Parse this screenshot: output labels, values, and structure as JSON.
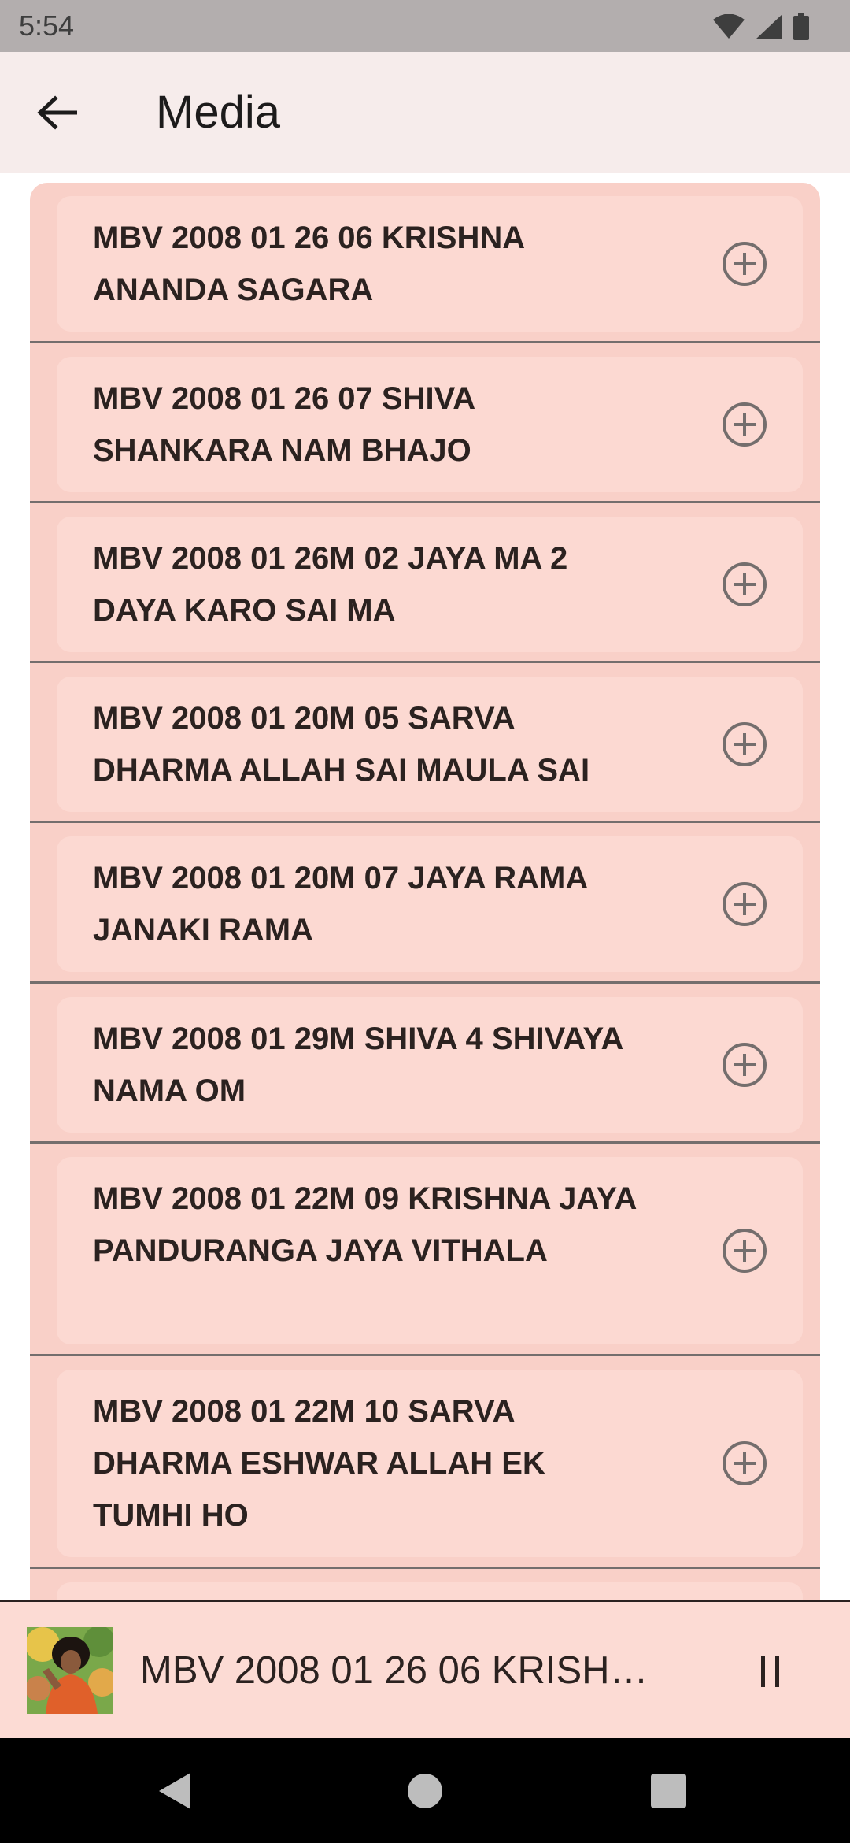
{
  "status_bar": {
    "time": "5:54"
  },
  "app_bar": {
    "title": "Media",
    "back_icon": "arrow-left-icon"
  },
  "media_list": [
    {
      "title": "MBV 2008 01 26 06 KRISHNA ANANDA SAGARA"
    },
    {
      "title": "MBV 2008 01 26 07 SHIVA SHANKARA NAM BHAJO"
    },
    {
      "title": "MBV 2008 01 26M 02 JAYA MA 2 DAYA KARO SAI MA"
    },
    {
      "title": "MBV 2008 01 20M 05 SARVA DHARMA ALLAH SAI MAULA SAI"
    },
    {
      "title": "MBV 2008 01 20M 07 JAYA RAMA JANAKI RAMA"
    },
    {
      "title": "MBV 2008 01 29M SHIVA 4 SHIVAYA NAMA OM"
    },
    {
      "title": "MBV 2008 01 22M 09 KRISHNA JAYA PANDURANGA JAYA VITHALA"
    },
    {
      "title": "MBV 2008 01 22M 10 SARVA DHARMA ESHWAR ALLAH EK TUMHI HO"
    }
  ],
  "player": {
    "now_playing": "MBV 2008 01 26 06 KRISHNA ANANDA SAGARA",
    "control_icon": "pause-icon"
  },
  "colors": {
    "list_background": "#f9d0c8",
    "card_background": "#fcd9d2",
    "app_bar": "#f6eceb",
    "status_bar": "#b3aeae"
  }
}
